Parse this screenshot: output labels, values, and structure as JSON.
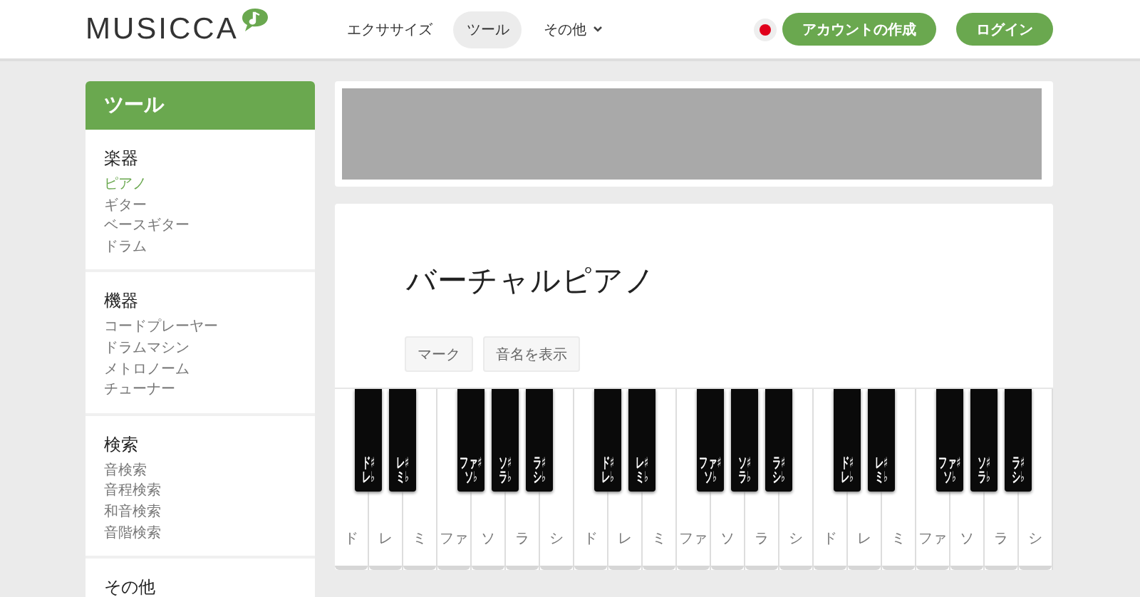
{
  "header": {
    "logo": "MUSICCA",
    "nav": [
      {
        "label": "エクササイズ",
        "selected": false,
        "dropdown": false
      },
      {
        "label": "ツール",
        "selected": true,
        "dropdown": false
      },
      {
        "label": "その他",
        "selected": false,
        "dropdown": true
      }
    ],
    "buttons": [
      "アカウントの作成",
      "ログイン"
    ]
  },
  "sidebar": {
    "title": "ツール",
    "groups": [
      {
        "title": "楽器",
        "items": [
          {
            "label": "ピアノ",
            "selected": true
          },
          {
            "label": "ギター",
            "selected": false
          },
          {
            "label": "ベースギター",
            "selected": false
          },
          {
            "label": "ドラム",
            "selected": false
          }
        ]
      },
      {
        "title": "機器",
        "items": [
          {
            "label": "コードプレーヤー",
            "selected": false
          },
          {
            "label": "ドラムマシン",
            "selected": false
          },
          {
            "label": "メトロノーム",
            "selected": false
          },
          {
            "label": "チューナー",
            "selected": false
          }
        ]
      },
      {
        "title": "検索",
        "items": [
          {
            "label": "音検索",
            "selected": false
          },
          {
            "label": "音程検索",
            "selected": false
          },
          {
            "label": "和音検索",
            "selected": false
          },
          {
            "label": "音階検索",
            "selected": false
          }
        ]
      },
      {
        "title": "その他"
      }
    ]
  },
  "main": {
    "title": "バーチャルピアノ",
    "buttons": [
      "マーク",
      "音名を表示"
    ],
    "keys": [
      {
        "kind": "white",
        "label": "ド"
      },
      {
        "kind": "black",
        "upper": "ド♯",
        "lower": "レ♭"
      },
      {
        "kind": "white",
        "label": "レ"
      },
      {
        "kind": "black",
        "upper": "レ♯",
        "lower": "ミ♭"
      },
      {
        "kind": "white",
        "label": "ミ"
      },
      {
        "kind": "white",
        "label": "ファ"
      },
      {
        "kind": "black",
        "upper": "ファ♯",
        "lower": "ソ♭"
      },
      {
        "kind": "white",
        "label": "ソ"
      },
      {
        "kind": "black",
        "upper": "ソ♯",
        "lower": "ラ♭"
      },
      {
        "kind": "white",
        "label": "ラ"
      },
      {
        "kind": "black",
        "upper": "ラ♯",
        "lower": "シ♭"
      },
      {
        "kind": "white",
        "label": "シ"
      },
      {
        "kind": "white",
        "label": "ド"
      },
      {
        "kind": "black",
        "upper": "ド♯",
        "lower": "レ♭"
      },
      {
        "kind": "white",
        "label": "レ"
      },
      {
        "kind": "black",
        "upper": "レ♯",
        "lower": "ミ♭"
      },
      {
        "kind": "white",
        "label": "ミ"
      },
      {
        "kind": "white",
        "label": "ファ"
      },
      {
        "kind": "black",
        "upper": "ファ♯",
        "lower": "ソ♭"
      },
      {
        "kind": "white",
        "label": "ソ"
      },
      {
        "kind": "black",
        "upper": "ソ♯",
        "lower": "ラ♭"
      },
      {
        "kind": "white",
        "label": "ラ"
      },
      {
        "kind": "black",
        "upper": "ラ♯",
        "lower": "シ♭"
      },
      {
        "kind": "white",
        "label": "シ"
      },
      {
        "kind": "white",
        "label": "ド"
      },
      {
        "kind": "black",
        "upper": "ド♯",
        "lower": "レ♭"
      },
      {
        "kind": "white",
        "label": "レ"
      },
      {
        "kind": "black",
        "upper": "レ♯",
        "lower": "ミ♭"
      },
      {
        "kind": "white",
        "label": "ミ"
      },
      {
        "kind": "white",
        "label": "ファ"
      },
      {
        "kind": "black",
        "upper": "ファ♯",
        "lower": "ソ♭"
      },
      {
        "kind": "white",
        "label": "ソ"
      },
      {
        "kind": "black",
        "upper": "ソ♯",
        "lower": "ラ♭"
      },
      {
        "kind": "white",
        "label": "ラ"
      },
      {
        "kind": "black",
        "upper": "ラ♯",
        "lower": "シ♭"
      },
      {
        "kind": "white",
        "label": "シ"
      }
    ]
  }
}
